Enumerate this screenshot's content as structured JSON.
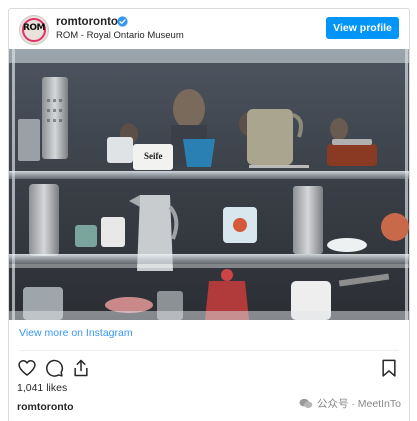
{
  "header": {
    "avatar_text": "ROM",
    "username": "romtoronto",
    "location": "ROM - Royal Ontario Museum",
    "view_profile_label": "View profile"
  },
  "post": {
    "view_more_label": "View more on Instagram",
    "likes": "1,041 likes",
    "owner": "romtoronto",
    "jar_label": "Seife"
  },
  "icons": {
    "verified": "verified-badge-icon",
    "like": "heart-icon",
    "comment": "comment-icon",
    "share": "share-icon",
    "save": "bookmark-icon"
  },
  "watermark": {
    "text": "公众号 · MeetInTo"
  },
  "colors": {
    "accent": "#0095f6",
    "link": "#3897f0"
  }
}
